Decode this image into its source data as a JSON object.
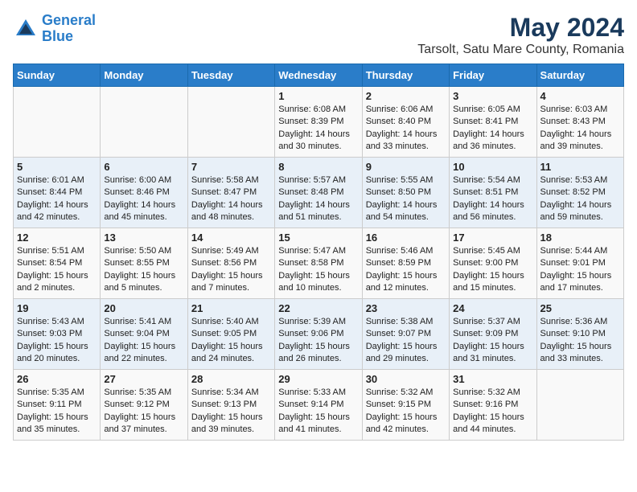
{
  "header": {
    "title": "May 2024",
    "subtitle": "Tarsolt, Satu Mare County, Romania",
    "logo_line1": "General",
    "logo_line2": "Blue"
  },
  "days_of_week": [
    "Sunday",
    "Monday",
    "Tuesday",
    "Wednesday",
    "Thursday",
    "Friday",
    "Saturday"
  ],
  "weeks": [
    [
      {
        "day": "",
        "content": ""
      },
      {
        "day": "",
        "content": ""
      },
      {
        "day": "",
        "content": ""
      },
      {
        "day": "1",
        "content": "Sunrise: 6:08 AM\nSunset: 8:39 PM\nDaylight: 14 hours\nand 30 minutes."
      },
      {
        "day": "2",
        "content": "Sunrise: 6:06 AM\nSunset: 8:40 PM\nDaylight: 14 hours\nand 33 minutes."
      },
      {
        "day": "3",
        "content": "Sunrise: 6:05 AM\nSunset: 8:41 PM\nDaylight: 14 hours\nand 36 minutes."
      },
      {
        "day": "4",
        "content": "Sunrise: 6:03 AM\nSunset: 8:43 PM\nDaylight: 14 hours\nand 39 minutes."
      }
    ],
    [
      {
        "day": "5",
        "content": "Sunrise: 6:01 AM\nSunset: 8:44 PM\nDaylight: 14 hours\nand 42 minutes."
      },
      {
        "day": "6",
        "content": "Sunrise: 6:00 AM\nSunset: 8:46 PM\nDaylight: 14 hours\nand 45 minutes."
      },
      {
        "day": "7",
        "content": "Sunrise: 5:58 AM\nSunset: 8:47 PM\nDaylight: 14 hours\nand 48 minutes."
      },
      {
        "day": "8",
        "content": "Sunrise: 5:57 AM\nSunset: 8:48 PM\nDaylight: 14 hours\nand 51 minutes."
      },
      {
        "day": "9",
        "content": "Sunrise: 5:55 AM\nSunset: 8:50 PM\nDaylight: 14 hours\nand 54 minutes."
      },
      {
        "day": "10",
        "content": "Sunrise: 5:54 AM\nSunset: 8:51 PM\nDaylight: 14 hours\nand 56 minutes."
      },
      {
        "day": "11",
        "content": "Sunrise: 5:53 AM\nSunset: 8:52 PM\nDaylight: 14 hours\nand 59 minutes."
      }
    ],
    [
      {
        "day": "12",
        "content": "Sunrise: 5:51 AM\nSunset: 8:54 PM\nDaylight: 15 hours\nand 2 minutes."
      },
      {
        "day": "13",
        "content": "Sunrise: 5:50 AM\nSunset: 8:55 PM\nDaylight: 15 hours\nand 5 minutes."
      },
      {
        "day": "14",
        "content": "Sunrise: 5:49 AM\nSunset: 8:56 PM\nDaylight: 15 hours\nand 7 minutes."
      },
      {
        "day": "15",
        "content": "Sunrise: 5:47 AM\nSunset: 8:58 PM\nDaylight: 15 hours\nand 10 minutes."
      },
      {
        "day": "16",
        "content": "Sunrise: 5:46 AM\nSunset: 8:59 PM\nDaylight: 15 hours\nand 12 minutes."
      },
      {
        "day": "17",
        "content": "Sunrise: 5:45 AM\nSunset: 9:00 PM\nDaylight: 15 hours\nand 15 minutes."
      },
      {
        "day": "18",
        "content": "Sunrise: 5:44 AM\nSunset: 9:01 PM\nDaylight: 15 hours\nand 17 minutes."
      }
    ],
    [
      {
        "day": "19",
        "content": "Sunrise: 5:43 AM\nSunset: 9:03 PM\nDaylight: 15 hours\nand 20 minutes."
      },
      {
        "day": "20",
        "content": "Sunrise: 5:41 AM\nSunset: 9:04 PM\nDaylight: 15 hours\nand 22 minutes."
      },
      {
        "day": "21",
        "content": "Sunrise: 5:40 AM\nSunset: 9:05 PM\nDaylight: 15 hours\nand 24 minutes."
      },
      {
        "day": "22",
        "content": "Sunrise: 5:39 AM\nSunset: 9:06 PM\nDaylight: 15 hours\nand 26 minutes."
      },
      {
        "day": "23",
        "content": "Sunrise: 5:38 AM\nSunset: 9:07 PM\nDaylight: 15 hours\nand 29 minutes."
      },
      {
        "day": "24",
        "content": "Sunrise: 5:37 AM\nSunset: 9:09 PM\nDaylight: 15 hours\nand 31 minutes."
      },
      {
        "day": "25",
        "content": "Sunrise: 5:36 AM\nSunset: 9:10 PM\nDaylight: 15 hours\nand 33 minutes."
      }
    ],
    [
      {
        "day": "26",
        "content": "Sunrise: 5:35 AM\nSunset: 9:11 PM\nDaylight: 15 hours\nand 35 minutes."
      },
      {
        "day": "27",
        "content": "Sunrise: 5:35 AM\nSunset: 9:12 PM\nDaylight: 15 hours\nand 37 minutes."
      },
      {
        "day": "28",
        "content": "Sunrise: 5:34 AM\nSunset: 9:13 PM\nDaylight: 15 hours\nand 39 minutes."
      },
      {
        "day": "29",
        "content": "Sunrise: 5:33 AM\nSunset: 9:14 PM\nDaylight: 15 hours\nand 41 minutes."
      },
      {
        "day": "30",
        "content": "Sunrise: 5:32 AM\nSunset: 9:15 PM\nDaylight: 15 hours\nand 42 minutes."
      },
      {
        "day": "31",
        "content": "Sunrise: 5:32 AM\nSunset: 9:16 PM\nDaylight: 15 hours\nand 44 minutes."
      },
      {
        "day": "",
        "content": ""
      }
    ]
  ]
}
